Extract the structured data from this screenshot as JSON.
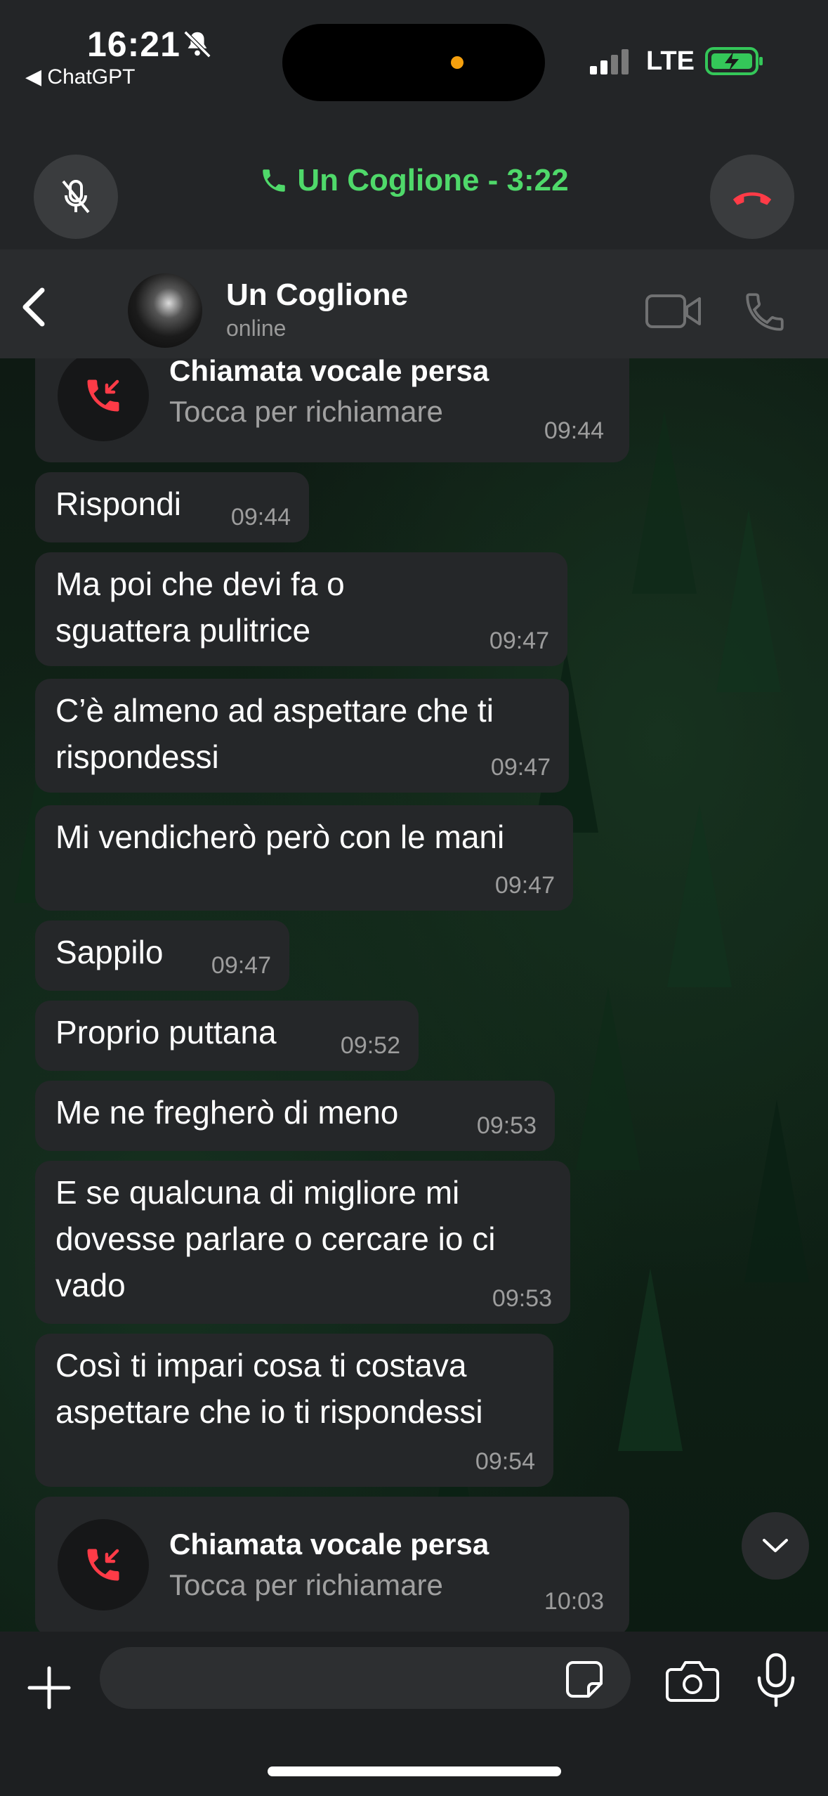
{
  "status_bar": {
    "time": "16:21",
    "back_app": "◀ ChatGPT",
    "network": "LTE"
  },
  "call_banner": {
    "title": "Un Coglione - 3:22",
    "accent_color": "#4fd96a",
    "end_color": "#ff3b47"
  },
  "chat_header": {
    "name": "Un Coglione",
    "status": "online"
  },
  "messages": [
    {
      "type": "missed_call",
      "title": "Chiamata vocale persa",
      "subtitle": "Tocca per richiamare",
      "time": "09:44"
    },
    {
      "type": "text",
      "text": "Rispondi",
      "time": "09:44"
    },
    {
      "type": "text",
      "text": "Ma poi che devi fa o sguattera pulitrice",
      "time": "09:47"
    },
    {
      "type": "text",
      "text": "C’è almeno ad aspettare che ti rispondessi",
      "time": "09:47"
    },
    {
      "type": "text",
      "text": "Mi vendicherò però con le mani",
      "time": "09:47"
    },
    {
      "type": "text",
      "text": "Sappilo",
      "time": "09:47"
    },
    {
      "type": "text",
      "text": "Proprio puttana",
      "time": "09:52"
    },
    {
      "type": "text",
      "text": "Me ne fregherò di meno",
      "time": "09:53"
    },
    {
      "type": "text",
      "text": "E se qualcuna di migliore mi dovesse parlare o cercare io ci vado",
      "time": "09:53"
    },
    {
      "type": "text",
      "text": "Così ti impari cosa ti costava aspettare che io ti rispondessi",
      "time": "09:54"
    },
    {
      "type": "missed_call",
      "title": "Chiamata vocale persa",
      "subtitle": "Tocca per richiamare",
      "time": "10:03"
    }
  ],
  "input_bar": {
    "placeholder": ""
  },
  "icons": [
    "bell-slash-icon",
    "signal-icon",
    "battery-charging-icon",
    "mic-off-icon",
    "phone-icon",
    "end-call-icon",
    "back-chevron-icon",
    "video-icon",
    "missed-call-icon",
    "chevron-down-icon",
    "plus-icon",
    "sticker-icon",
    "camera-icon",
    "mic-icon"
  ]
}
